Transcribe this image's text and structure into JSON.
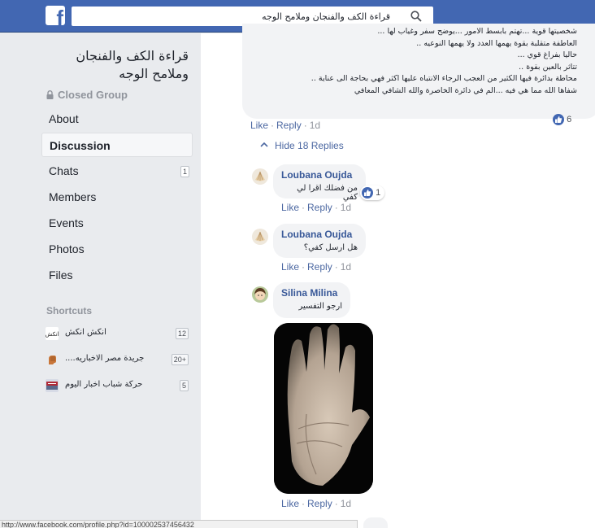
{
  "topbar": {
    "logo": "f",
    "search_value": "قراءة الكف والفنجان وملامح الوجه"
  },
  "sidebar": {
    "group_title_line1": "قراءة الكف والفنجان",
    "group_title_line2": "وملامح الوجه",
    "privacy": "Closed Group",
    "nav": [
      {
        "label": "About"
      },
      {
        "label": "Discussion",
        "active": true
      },
      {
        "label": "Chats",
        "badge": "1"
      },
      {
        "label": "Members"
      },
      {
        "label": "Events"
      },
      {
        "label": "Photos"
      },
      {
        "label": "Files"
      }
    ],
    "shortcuts_title": "Shortcuts",
    "shortcuts": [
      {
        "label": "أنكش انكش",
        "badge": "12"
      },
      {
        "label": "جريدة مصر الاخباريه....",
        "badge": "20+"
      },
      {
        "label": "حركة شباب اخبار اليوم",
        "badge": "5"
      }
    ]
  },
  "post": {
    "lines": [
      "شخصيتها قوية ...تهتم بابسط الامور ...يوضح سفر وغياب لها ...",
      "العاطفة متقلبة بقوة يهمها العدد ولا يهمها النوعيه ..",
      "حاليا بفراغ قوي ...",
      "تتاثر بالعين بقوة ..",
      "محاطة بدائرة فيها الكثير من العجب الرجاء الانتباه عليها اكثر فهي بحاجة الى عناية ..",
      "شفاها الله مما هي فيه ...الم في دائرة الخاصرة والله الشافي المعافي"
    ],
    "like": "Like",
    "reply": "Reply",
    "time": "1d",
    "reaction_count": "6",
    "hide_replies": "Hide 18 Replies"
  },
  "replies": [
    {
      "name": "Loubana Oujda",
      "text": "من فضلك اقرا لي كفي",
      "reaction_count": "1",
      "like": "Like",
      "reply": "Reply",
      "time": "1d"
    },
    {
      "name": "Loubana Oujda",
      "text": "هل ارسل كفي؟",
      "like": "Like",
      "reply": "Reply",
      "time": "1d"
    },
    {
      "name": "Silina Milina",
      "text": "ارجو التفسير",
      "like": "Like",
      "reply": "Reply",
      "time": "1d"
    }
  ],
  "status_url": "http://www.facebook.com/profile.php?id=100002537456432",
  "colors": {
    "brand": "#4267b2",
    "link": "#4b67a1",
    "name": "#385898",
    "meta": "#90949c"
  },
  "icons": [
    "facebook-logo-icon",
    "search-icon",
    "lock-icon",
    "like-reaction-icon",
    "chevron-up-icon"
  ]
}
